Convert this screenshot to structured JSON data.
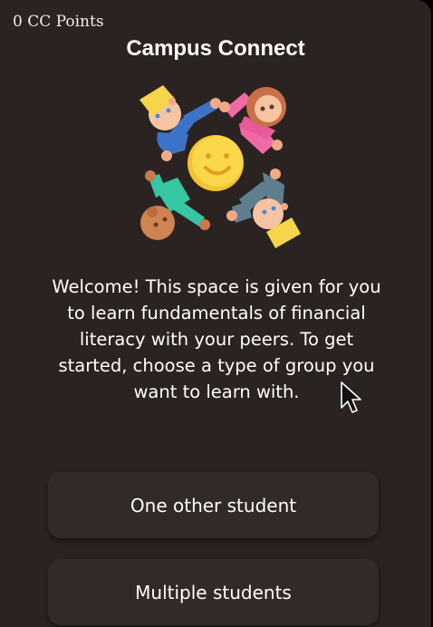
{
  "header": {
    "points_text": "0 CC Points",
    "title": "Campus Connect"
  },
  "illustration": {
    "icon": "group-of-four-people-icon"
  },
  "welcome_text": "Welcome! This space is given for you to learn fundamentals of financial literacy with your peers. To get started, choose a type of group you want to learn with.",
  "options": [
    {
      "label": "One other student"
    },
    {
      "label": "Multiple students"
    }
  ]
}
